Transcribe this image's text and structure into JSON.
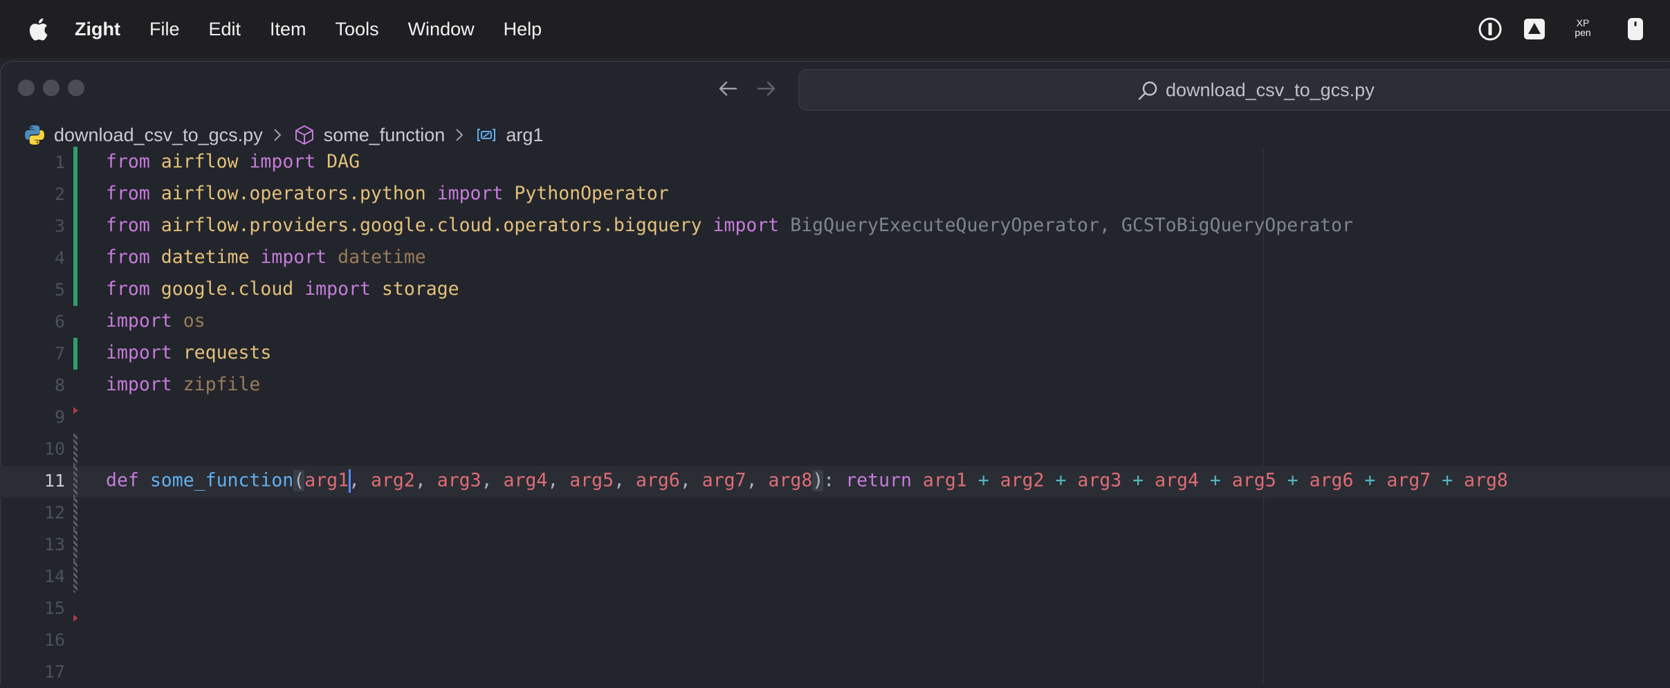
{
  "menubar": {
    "app_name": "Zight",
    "items": [
      "File",
      "Edit",
      "Item",
      "Tools",
      "Window",
      "Help"
    ],
    "tray_icons": [
      "1password-icon",
      "drive-upload-icon",
      "xp-pen-icon",
      "mouse-icon"
    ],
    "tray_xp_label": "XP\npen"
  },
  "window": {
    "search": {
      "text": "download_csv_to_gcs.py"
    },
    "breadcrumb": [
      {
        "label": "download_csv_to_gcs.py",
        "icon": "python-icon"
      },
      {
        "label": "some_function",
        "icon": "cube-icon"
      },
      {
        "label": "arg1",
        "icon": "variable-icon"
      }
    ]
  },
  "editor": {
    "active_line": 11,
    "line_numbers": [
      "1",
      "2",
      "3",
      "4",
      "5",
      "6",
      "7",
      "8",
      "9",
      "10",
      "11",
      "12",
      "13",
      "14",
      "15",
      "16",
      "17"
    ],
    "lines": {
      "l1": [
        "from",
        "airflow",
        "import",
        "DAG"
      ],
      "l2": [
        "from",
        "airflow.operators.python",
        "import",
        "PythonOperator"
      ],
      "l3": [
        "from",
        "airflow.providers.google.cloud.operators.bigquery",
        "import",
        "BigQueryExecuteQueryOperator, GCSToBigQueryOperator"
      ],
      "l4": [
        "from",
        "datetime",
        "import",
        "datetime"
      ],
      "l5": [
        "from",
        "google.cloud",
        "import",
        "storage"
      ],
      "l6": [
        "import",
        "os"
      ],
      "l7": [
        "import",
        "requests"
      ],
      "l8": [
        "import",
        "zipfile"
      ],
      "l11": {
        "def": "def",
        "name": "some_function",
        "params": [
          "arg1",
          "arg2",
          "arg3",
          "arg4",
          "arg5",
          "arg6",
          "arg7",
          "arg8"
        ],
        "return": "return",
        "op": "+"
      }
    }
  },
  "colors": {
    "keyword": "#c57bdb",
    "module": "#e5c07b",
    "function": "#61afef",
    "parameter": "#e06c75",
    "operator": "#56b6c2",
    "gutter_added": "#2f9e6a"
  }
}
